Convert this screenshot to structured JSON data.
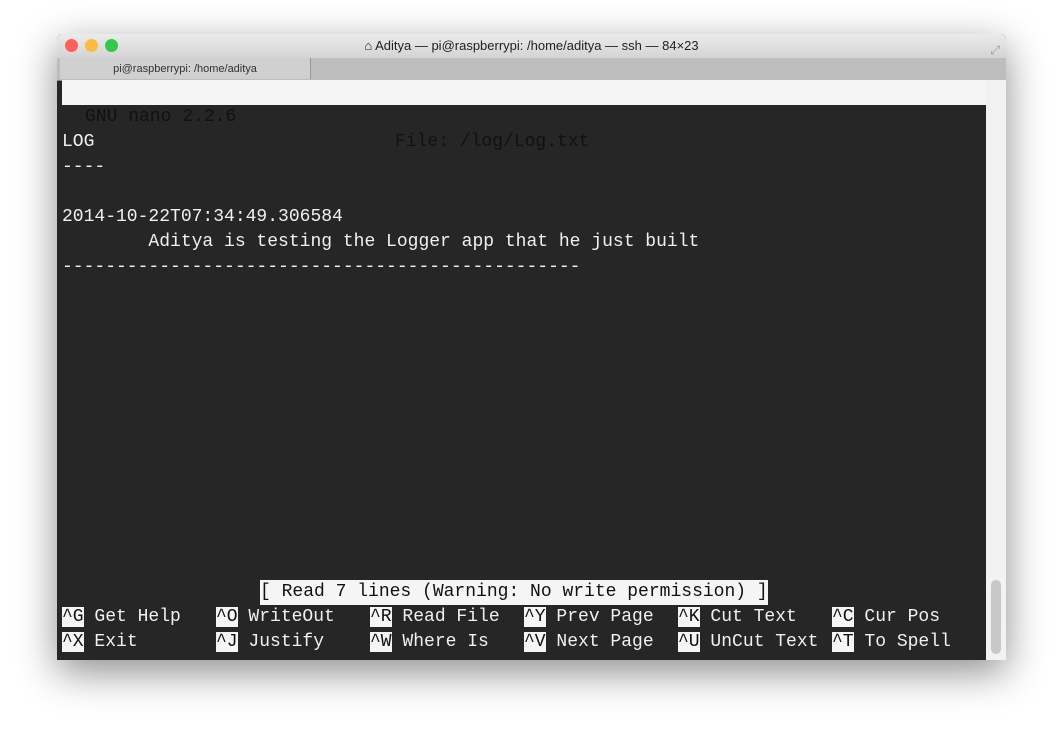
{
  "window": {
    "title": "Aditya — pi@raspberrypi: /home/aditya — ssh — 84×23",
    "tab": "pi@raspberrypi: /home/aditya"
  },
  "nano": {
    "header_left": "GNU nano 2.2.6",
    "header_file": "File: /log/Log.txt",
    "lines": [
      "LOG",
      "----",
      "",
      "2014-10-22T07:34:49.306584",
      "        Aditya is testing the Logger app that he just built",
      "------------------------------------------------"
    ],
    "status": "[ Read 7 lines (Warning: No write permission) ]",
    "shortcuts": [
      [
        {
          "key": "^G",
          "label": "Get Help"
        },
        {
          "key": "^O",
          "label": "WriteOut"
        },
        {
          "key": "^R",
          "label": "Read File"
        },
        {
          "key": "^Y",
          "label": "Prev Page"
        },
        {
          "key": "^K",
          "label": "Cut Text"
        },
        {
          "key": "^C",
          "label": "Cur Pos"
        }
      ],
      [
        {
          "key": "^X",
          "label": "Exit"
        },
        {
          "key": "^J",
          "label": "Justify"
        },
        {
          "key": "^W",
          "label": "Where Is"
        },
        {
          "key": "^V",
          "label": "Next Page"
        },
        {
          "key": "^U",
          "label": "UnCut Text"
        },
        {
          "key": "^T",
          "label": "To Spell"
        }
      ]
    ]
  },
  "colors": {
    "terminal_bg": "#262626",
    "close": "#fc605b",
    "minimize": "#fdbc40",
    "zoom": "#34c84a"
  }
}
